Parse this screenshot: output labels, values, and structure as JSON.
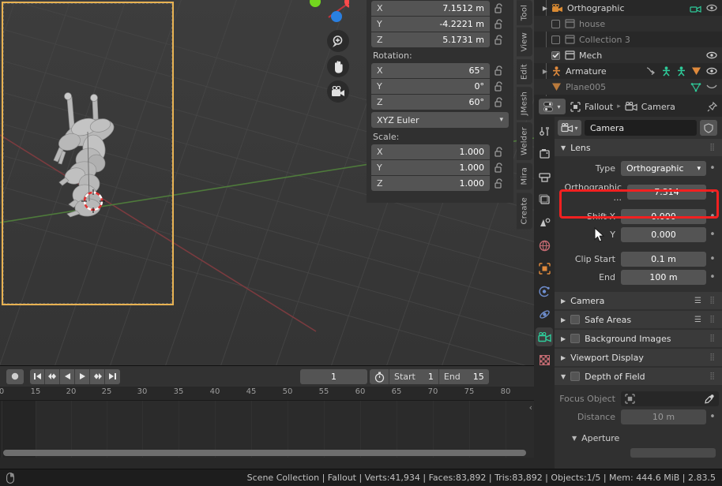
{
  "viewport": {
    "camera_frame_label": "camera-view-border",
    "gizmo": {
      "axes": [
        "X",
        "Y",
        "Z"
      ],
      "x_color": "#fc4b4b",
      "y_color": "#73d61f",
      "z_color": "#2a7fe0"
    },
    "nav_buttons": [
      {
        "name": "zoom-icon",
        "glyph": "zoom"
      },
      {
        "name": "hand-icon",
        "glyph": "hand"
      },
      {
        "name": "camera-icon",
        "glyph": "camera"
      }
    ]
  },
  "npanel": {
    "location_rows": [
      {
        "axis": "X",
        "value": "7.1512 m"
      },
      {
        "axis": "Y",
        "value": "-4.2221 m"
      },
      {
        "axis": "Z",
        "value": "5.1731 m"
      }
    ],
    "rotation_label": "Rotation:",
    "rotation_rows": [
      {
        "axis": "X",
        "value": "65°"
      },
      {
        "axis": "Y",
        "value": "0°"
      },
      {
        "axis": "Z",
        "value": "60°"
      }
    ],
    "rotation_mode": "XYZ Euler",
    "scale_label": "Scale:",
    "scale_rows": [
      {
        "axis": "X",
        "value": "1.000"
      },
      {
        "axis": "Y",
        "value": "1.000"
      },
      {
        "axis": "Z",
        "value": "1.000"
      }
    ]
  },
  "vtabs": [
    "Tool",
    "View",
    "Edit",
    "JMesh",
    "Welder",
    "Mira",
    "Create"
  ],
  "timeline": {
    "record_button": "record",
    "playback_buttons": [
      "jump-start",
      "prev-keyframe",
      "play-reverse",
      "play",
      "next-keyframe",
      "jump-end"
    ],
    "current_frame": "1",
    "start_label": "Start",
    "start_value": "1",
    "end_label": "End",
    "end_value": "15",
    "ruler_ticks": [
      "0",
      "15",
      "20",
      "25",
      "30",
      "35",
      "40",
      "45",
      "50",
      "55",
      "60",
      "65",
      "70",
      "75",
      "80"
    ]
  },
  "outliner": {
    "rows": [
      {
        "name": "Orthographic",
        "type": "camera",
        "dim": false,
        "checkbox": null,
        "eye": true,
        "partial": true
      },
      {
        "name": "house",
        "type": "collection",
        "dim": true,
        "checkbox": false,
        "eye": false
      },
      {
        "name": "Collection 3",
        "type": "collection",
        "dim": true,
        "checkbox": false,
        "eye": false
      },
      {
        "name": "Mech",
        "type": "collection",
        "dim": false,
        "checkbox": true,
        "eye": true
      },
      {
        "name": "Armature",
        "type": "armature",
        "dim": false,
        "checkbox": null,
        "eye": true
      },
      {
        "name": "Plane005",
        "type": "mesh",
        "dim": true,
        "checkbox": null,
        "eye": false
      }
    ]
  },
  "properties": {
    "breadcrumb": {
      "scene": "Fallout",
      "object": "Camera"
    },
    "id_name": "Camera",
    "tabs": [
      "tool-tab",
      "render-tab",
      "output-tab",
      "view-layer-tab",
      "scene-tab",
      "world-tab",
      "object-tab",
      "modifier-tab",
      "physics-tab",
      "object-data-camera-tab",
      "texture-tab"
    ],
    "active_tab": "object-data-camera-tab",
    "lens": {
      "title": "Lens",
      "type_label": "Type",
      "type_value": "Orthographic",
      "ortho_scale_label": "Orthographic ...",
      "ortho_scale_value": "7.314",
      "shift_x_label": "Shift X",
      "shift_x_value": "0.000",
      "shift_y_label": "Y",
      "shift_y_value": "0.000",
      "clip_start_label": "Clip Start",
      "clip_start_value": "0.1 m",
      "clip_end_label": "End",
      "clip_end_value": "100 m"
    },
    "sections": [
      {
        "title": "Camera",
        "checkbox": false,
        "has_checkbox": false,
        "open": false,
        "list_icon": true
      },
      {
        "title": "Safe Areas",
        "checkbox": false,
        "has_checkbox": true,
        "open": false,
        "list_icon": true
      },
      {
        "title": "Background Images",
        "checkbox": false,
        "has_checkbox": true,
        "open": false,
        "list_icon": false
      },
      {
        "title": "Viewport Display",
        "checkbox": false,
        "has_checkbox": false,
        "open": false,
        "list_icon": false
      },
      {
        "title": "Depth of Field",
        "checkbox": false,
        "has_checkbox": true,
        "open": true,
        "list_icon": false
      }
    ],
    "dof": {
      "focus_object_label": "Focus Object",
      "focus_object_value": "",
      "distance_label": "Distance",
      "distance_value": "10 m",
      "aperture_title": "Aperture"
    }
  },
  "statusbar": {
    "text": "Scene Collection | Fallout | Verts:41,934 | Faces:83,892 | Tris:83,892 | Objects:1/5 | Mem: 444.6 MiB | 2.83.5"
  },
  "colors": {
    "accent_orange": "#e8b252",
    "highlight_red": "#f22020",
    "camera_green": "#2ecc9a",
    "armature_orange": "#e08a3c"
  }
}
